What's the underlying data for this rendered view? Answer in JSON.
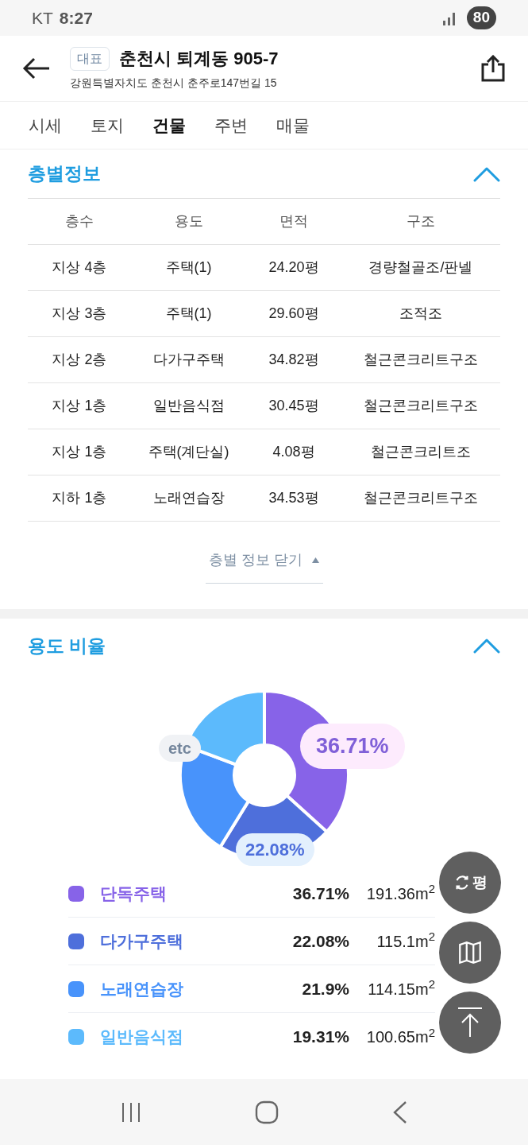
{
  "status_bar": {
    "carrier": "KT",
    "time": "8:27",
    "battery": "80"
  },
  "header": {
    "badge": "대표",
    "title": "춘천시 퇴계동 905-7",
    "address": "강원특별자치도 춘천시 춘주로147번길 15"
  },
  "tabs": [
    {
      "label": "시세",
      "selected": false
    },
    {
      "label": "토지",
      "selected": false
    },
    {
      "label": "건물",
      "selected": true
    },
    {
      "label": "주변",
      "selected": false
    },
    {
      "label": "매물",
      "selected": false
    }
  ],
  "floor_section": {
    "title": "층별정보",
    "expanded": true,
    "columns": [
      "층수",
      "용도",
      "면적",
      "구조"
    ],
    "rows": [
      [
        "지상 4층",
        "주택(1)",
        "24.20평",
        "경량철골조/판넬"
      ],
      [
        "지상 3층",
        "주택(1)",
        "29.60평",
        "조적조"
      ],
      [
        "지상 2층",
        "다가구주택",
        "34.82평",
        "철근콘크리트구조"
      ],
      [
        "지상 1층",
        "일반음식점",
        "30.45평",
        "철근콘크리트구조"
      ],
      [
        "지상 1층",
        "주택(계단실)",
        "4.08평",
        "철근콘크리트조"
      ],
      [
        "지하 1층",
        "노래연습장",
        "34.53평",
        "철근콘크리트구조"
      ]
    ],
    "close_button": "층별 정보 닫기"
  },
  "usage_section": {
    "title": "용도 비율",
    "expanded": true,
    "chart_data": {
      "type": "donut",
      "categories": [
        "단독주택",
        "다가구주택",
        "노래연습장",
        "일반음식점"
      ],
      "values": [
        36.71,
        22.08,
        21.9,
        19.31
      ],
      "annotations": [
        {
          "text": "36.71%"
        },
        {
          "text": "22.08%"
        },
        {
          "text": "etc"
        }
      ]
    },
    "legend": [
      {
        "color": "#8763e8",
        "percent": "36.71%",
        "area": "191.36m$^{2}$"
      },
      {
        "color": "#4e6fdb",
        "percent": "22.08%",
        "area": "115.1m$^{2}$"
      },
      {
        "color": "#4893fb",
        "percent": "21.9%",
        "area": "114.15m$^{2}$"
      },
      {
        "color": "#5cbafc",
        "percent": "19.31%",
        "area": "100.65m$^{2}$"
      }
    ]
  },
  "floating_buttons": [
    {
      "kind": "unit",
      "label": "평"
    },
    {
      "kind": "map"
    },
    {
      "kind": "top"
    }
  ]
}
